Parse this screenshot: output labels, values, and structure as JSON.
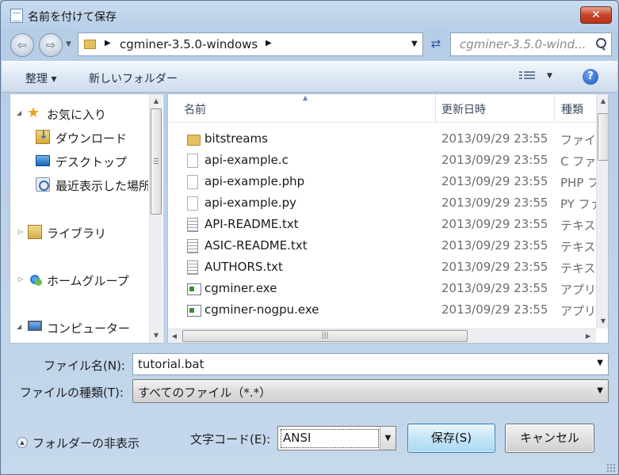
{
  "window": {
    "title": "名前を付けて保存",
    "close_glyph": "✕"
  },
  "nav": {
    "back_glyph": "⇦",
    "forward_glyph": "⇨",
    "address_path": "cgminer-3.5.0-windows",
    "refresh_glyph": "⇄",
    "search_placeholder": "cgminer-3.5.0-wind..."
  },
  "toolbar": {
    "organize_label": "整理 ▾",
    "new_folder_label": "新しいフォルダー",
    "help_glyph": "?"
  },
  "sidebar": {
    "items": [
      {
        "label": "お気に入り",
        "icon": "star-icon"
      },
      {
        "label": "ダウンロード",
        "icon": "download-folder-icon"
      },
      {
        "label": "デスクトップ",
        "icon": "desktop-icon"
      },
      {
        "label": "最近表示した場所",
        "icon": "recent-places-icon"
      },
      {
        "label": "ライブラリ",
        "icon": "library-icon"
      },
      {
        "label": "ホームグループ",
        "icon": "homegroup-icon"
      },
      {
        "label": "コンピューター",
        "icon": "computer-icon"
      }
    ]
  },
  "files": {
    "columns": {
      "name": "名前",
      "date": "更新日時",
      "type": "種類"
    },
    "rows": [
      {
        "name": "bitstreams",
        "date": "2013/09/29 23:55",
        "type": "ファイ",
        "icon": "folder-icon"
      },
      {
        "name": "api-example.c",
        "date": "2013/09/29 23:55",
        "type": "C ファ",
        "icon": "file-icon"
      },
      {
        "name": "api-example.php",
        "date": "2013/09/29 23:55",
        "type": "PHP フ",
        "icon": "file-icon"
      },
      {
        "name": "api-example.py",
        "date": "2013/09/29 23:55",
        "type": "PY ファ",
        "icon": "file-icon"
      },
      {
        "name": "API-README.txt",
        "date": "2013/09/29 23:55",
        "type": "テキス",
        "icon": "text-file-icon"
      },
      {
        "name": "ASIC-README.txt",
        "date": "2013/09/29 23:55",
        "type": "テキス",
        "icon": "text-file-icon"
      },
      {
        "name": "AUTHORS.txt",
        "date": "2013/09/29 23:55",
        "type": "テキス",
        "icon": "text-file-icon"
      },
      {
        "name": "cgminer.exe",
        "date": "2013/09/29 23:55",
        "type": "アプリ",
        "icon": "exe-icon"
      },
      {
        "name": "cgminer-nogpu.exe",
        "date": "2013/09/29 23:55",
        "type": "アプリ",
        "icon": "exe-icon"
      }
    ]
  },
  "form": {
    "filename_label": "ファイル名(N):",
    "filename_value": "tutorial.bat",
    "filetype_label": "ファイルの種類(T):",
    "filetype_value": "すべてのファイル（*.*）",
    "hide_folders_label": "フォルダーの非表示",
    "encoding_label": "文字コード(E):",
    "encoding_value": "ANSI",
    "save_label": "保存(S)",
    "cancel_label": "キャンセル"
  }
}
